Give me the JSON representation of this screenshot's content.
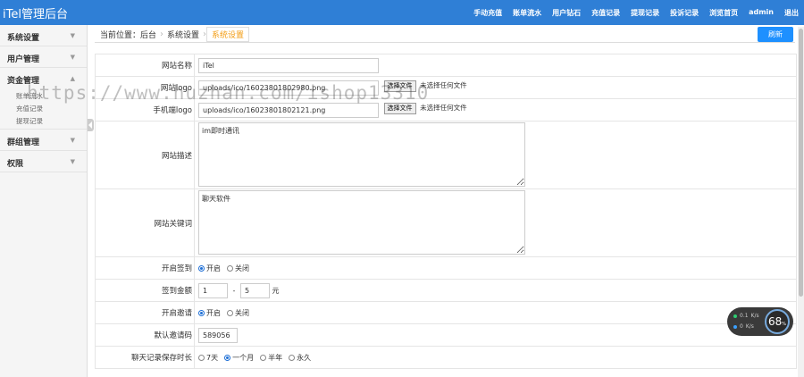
{
  "header": {
    "brand": "iTel管理后台",
    "nav": [
      "手动充值",
      "账单流水",
      "用户钻石",
      "充值记录",
      "提现记录",
      "投诉记录",
      "浏览首页",
      "admin",
      "退出"
    ]
  },
  "sidebar": {
    "groups": [
      {
        "label": "系统设置"
      },
      {
        "label": "用户管理"
      },
      {
        "label": "资金管理",
        "subitems": [
          "账单流水",
          "充值记录",
          "提现记录"
        ]
      },
      {
        "label": "群组管理"
      },
      {
        "label": "权限"
      }
    ]
  },
  "breadcrumb": {
    "items": [
      "当前位置：后台",
      "系统设置",
      "系统设置"
    ]
  },
  "toolbar": {
    "refresh_label": "刷新"
  },
  "form": {
    "site_name": {
      "label": "网站名称",
      "value": "iTel"
    },
    "site_logo": {
      "label": "网站logo",
      "value": "uploads/ico/16023801802980.png",
      "button": "选择文件",
      "status": "未选择任何文件"
    },
    "mobile_logo": {
      "label": "手机端logo",
      "value": "uploads/ico/16023801802121.png",
      "button": "选择文件",
      "status": "未选择任何文件"
    },
    "site_desc": {
      "label": "网站描述",
      "value": "im即时通讯"
    },
    "site_keywords": {
      "label": "网站关键词",
      "value": "聊天软件"
    },
    "signin": {
      "label": "开启签到",
      "options": [
        "开启",
        "关闭"
      ],
      "selected": 0
    },
    "signin_amount": {
      "label": "签到金额",
      "min": "1",
      "max": "5",
      "unit": "元",
      "sep": "-"
    },
    "invite": {
      "label": "开启邀请",
      "options": [
        "开启",
        "关闭"
      ],
      "selected": 0
    },
    "default_invite_code": {
      "label": "默认邀请码",
      "value": "589056"
    },
    "chat_retention": {
      "label": "聊天记录保存时长",
      "options": [
        "7天",
        "一个月",
        "半年",
        "永久"
      ],
      "selected": 1
    }
  },
  "watermark": "https://www.huzhan.com/ishop13310",
  "net_widget": {
    "up": "0.1",
    "down": "0",
    "unit": "K/s",
    "percent": "68",
    "percent_unit": "%"
  }
}
